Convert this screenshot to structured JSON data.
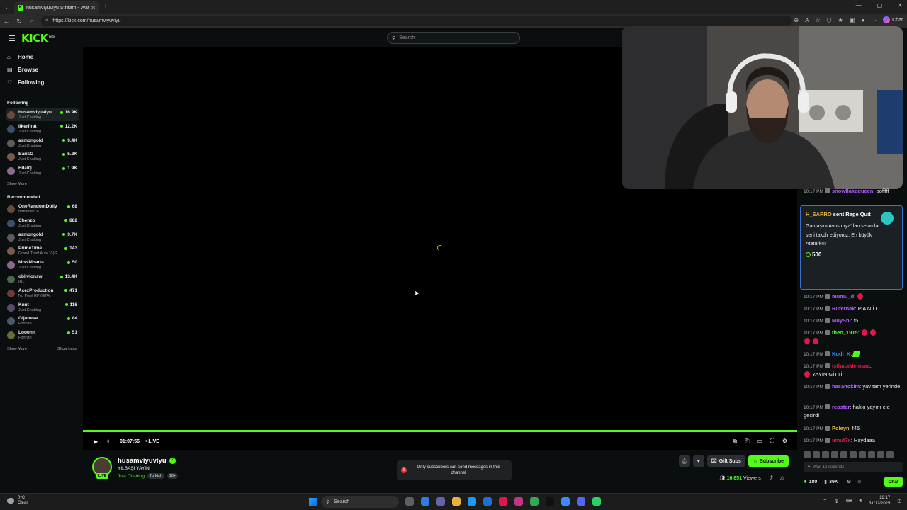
{
  "browser": {
    "tab_title": "husamviyuviyu Stream - Watch Live on Kick",
    "url": "https://kick.com/husamviyuviyu",
    "chat_label": "Chat"
  },
  "kick": {
    "logo": "KICK",
    "logo_beta": "beta",
    "search_placeholder": "Search"
  },
  "sidebar": {
    "nav": [
      {
        "label": "Home",
        "icon": "home-icon"
      },
      {
        "label": "Browse",
        "icon": "browse-icon"
      },
      {
        "label": "Following",
        "icon": "heart-icon"
      }
    ],
    "following_title": "Following",
    "following": [
      {
        "name": "husamviyuviyu",
        "category": "Just Chatting",
        "viewers": "16.9K"
      },
      {
        "name": "ilkerfirat",
        "category": "Just Chatting",
        "viewers": "12.2K"
      },
      {
        "name": "asmongold",
        "category": "Just Chatting",
        "viewers": "9.4K"
      },
      {
        "name": "BarisG",
        "category": "Just Chatting",
        "viewers": "5.2K"
      },
      {
        "name": "HilalQ",
        "category": "Just Chatting",
        "viewers": "1.9K"
      }
    ],
    "show_more_1": "Show More",
    "recommended_title": "Recommended",
    "recommended": [
      {
        "name": "OneRandomDolly",
        "category": "Battlefield 6",
        "viewers": "68"
      },
      {
        "name": "Chenzo",
        "category": "Just Chatting",
        "viewers": "882"
      },
      {
        "name": "asmongold",
        "category": "Just Chatting",
        "viewers": "9.7K"
      },
      {
        "name": "PrimeTime",
        "category": "Grand Theft Auto V (G...",
        "viewers": "143"
      },
      {
        "name": "MissMoarta",
        "category": "Just Chatting",
        "viewers": "50"
      },
      {
        "name": "oblivionsw",
        "category": "IRL",
        "viewers": "13.4K"
      },
      {
        "name": "AcezProduction",
        "category": "No Pixel RP (GTA)",
        "viewers": "471"
      },
      {
        "name": "Knut",
        "category": "Just Chatting",
        "viewers": "116"
      },
      {
        "name": "Gijanesa",
        "category": "Fortnite",
        "viewers": "84"
      },
      {
        "name": "Looonn",
        "category": "Fortnite",
        "viewers": "51"
      }
    ],
    "show_more_2": "Show More",
    "show_less": "Show Less"
  },
  "player": {
    "time": "01:07:56",
    "live": "• LIVE"
  },
  "stream": {
    "streamer": "husamviyuviyu",
    "title": "YILBAŞI YAYINI",
    "category": "Just Chatting",
    "tags": [
      "Turkish",
      "18+"
    ],
    "live_badge": "LIVE",
    "toast": "Only subscribers can send messages in this channel",
    "gift_subs": "Gift Subs",
    "subscribe": "Subscribe",
    "viewers": "16,851",
    "viewers_label": "Viewers"
  },
  "chat": {
    "messages": [
      {
        "time": "10:17 PM",
        "user": "snowflakequeen",
        "color": "#b45cff",
        "text": "oofffff"
      },
      {
        "time": "10:17 PM",
        "user": "mumu_d",
        "color": "#b45cff",
        "text": "",
        "emotes": [
          "red"
        ]
      },
      {
        "time": "10:17 PM",
        "user": "Rufernak",
        "color": "#b45cff",
        "text": "P A N İ C"
      },
      {
        "time": "10:17 PM",
        "user": "MuyShi",
        "color": "#b45cff",
        "text": "f5"
      },
      {
        "time": "10:17 PM",
        "user": "theo_1915",
        "color": "#53fc18",
        "text": "",
        "emotes": [
          "red",
          "red",
          "red",
          "red"
        ]
      },
      {
        "time": "10:17 PM",
        "user": "Kudi_K",
        "color": "#3b8cff",
        "text": "",
        "emotes": [
          "green"
        ]
      },
      {
        "time": "10:17 PM",
        "user": "isthataMemsaa",
        "color": "#e0174a",
        "text": "YAYIN GİTTİ",
        "emotes": [
          "red"
        ]
      },
      {
        "time": "10:17 PM",
        "user": "hasanokim",
        "color": "#b45cff",
        "text": "yav tam yerinde"
      },
      {
        "time": "10:17 PM",
        "user": "rcpstar",
        "color": "#b45cff",
        "text": "hakkı yayını ele geçirdi"
      },
      {
        "time": "10:17 PM",
        "user": "Poleyn",
        "color": "#e8b23a",
        "text": "f45"
      },
      {
        "time": "10:17 PM",
        "user": "umut7s",
        "color": "#e0174a",
        "text": "Haydaaa"
      }
    ],
    "gift": {
      "sender": "H_SARRO",
      "action": "sent",
      "item": "Rage Quit",
      "message": "Gardaşım Avusturya'dan selamlar seni takdir ediyoruz. En büyük Atatürk!!!",
      "amount": "500"
    },
    "input_placeholder": "Wait 12 seconds",
    "kicks_balance": "180",
    "points": "39K",
    "chat_button": "Chat"
  },
  "taskbar": {
    "temp": "0°C",
    "weather": "Clear",
    "search": "Search",
    "time": "22:17",
    "date": "31/12/2025"
  }
}
